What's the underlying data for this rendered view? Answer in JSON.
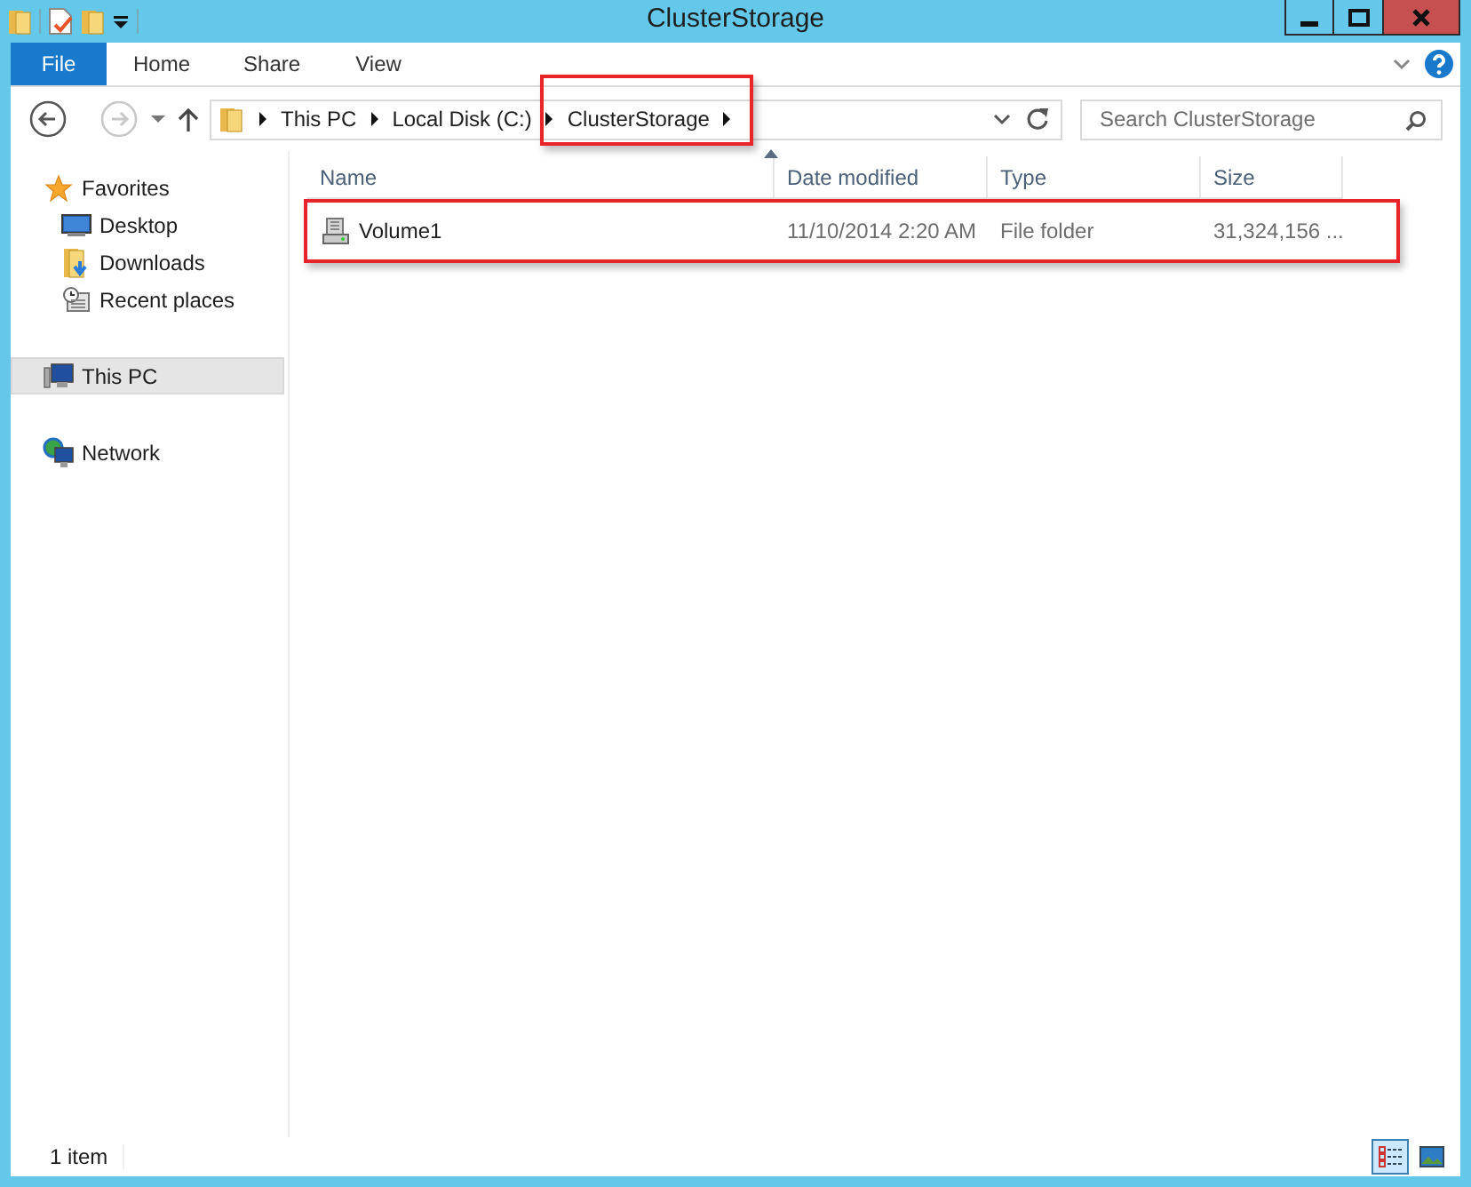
{
  "window": {
    "title": "ClusterStorage"
  },
  "ribbon": {
    "tabs": [
      {
        "label": "File",
        "kind": "file"
      },
      {
        "label": "Home",
        "kind": "tab"
      },
      {
        "label": "Share",
        "kind": "tab"
      },
      {
        "label": "View",
        "kind": "tab"
      }
    ]
  },
  "address_bar": {
    "breadcrumbs": [
      {
        "label": "This PC",
        "highlighted": false
      },
      {
        "label": "Local Disk (C:)",
        "highlighted": false
      },
      {
        "label": "ClusterStorage",
        "highlighted": true
      }
    ]
  },
  "search": {
    "placeholder": "Search ClusterStorage"
  },
  "sidebar": {
    "items": [
      {
        "label": "Favorites",
        "kind": "favorites",
        "selected": false,
        "children": [
          {
            "label": "Desktop",
            "kind": "desktop",
            "selected": false
          },
          {
            "label": "Downloads",
            "kind": "downloads",
            "selected": false
          },
          {
            "label": "Recent places",
            "kind": "recent",
            "selected": false
          }
        ]
      },
      {
        "label": "This PC",
        "kind": "pc",
        "selected": true
      },
      {
        "label": "Network",
        "kind": "network",
        "selected": false
      }
    ]
  },
  "table": {
    "columns": [
      "Name",
      "Date modified",
      "Type",
      "Size"
    ],
    "rows": [
      {
        "name": "Volume1",
        "date_modified": "11/10/2014 2:20 AM",
        "type": "File folder",
        "size": "31,324,156 ...",
        "highlighted": true
      }
    ]
  },
  "status_bar": {
    "count": "1 item",
    "views": [
      {
        "kind": "details",
        "selected": true
      },
      {
        "kind": "large_icons",
        "selected": false
      }
    ]
  }
}
